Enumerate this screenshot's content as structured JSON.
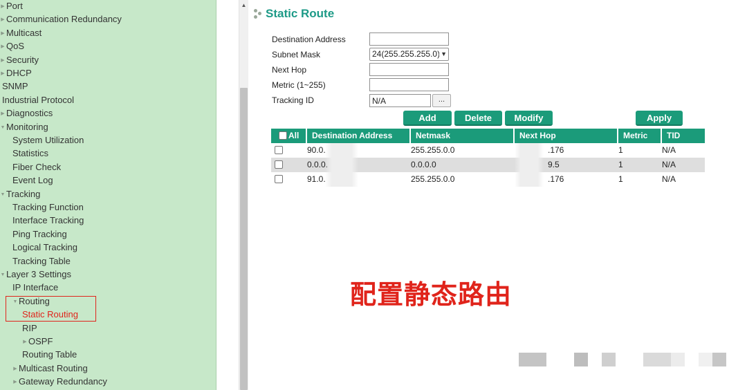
{
  "nav": {
    "items": [
      {
        "label": "Port",
        "indent": 0,
        "arrow": "right"
      },
      {
        "label": "Communication Redundancy",
        "indent": 0,
        "arrow": "right"
      },
      {
        "label": "Multicast",
        "indent": 0,
        "arrow": "right"
      },
      {
        "label": "QoS",
        "indent": 0,
        "arrow": "right"
      },
      {
        "label": "Security",
        "indent": 0,
        "arrow": "right"
      },
      {
        "label": "DHCP",
        "indent": 0,
        "arrow": "right"
      },
      {
        "label": "SNMP",
        "indent": 0,
        "arrow": "none"
      },
      {
        "label": "Industrial Protocol",
        "indent": 0,
        "arrow": "none"
      },
      {
        "label": "Diagnostics",
        "indent": 0,
        "arrow": "right"
      },
      {
        "label": "Monitoring",
        "indent": 0,
        "arrow": "down"
      },
      {
        "label": "System Utilization",
        "indent": 1,
        "arrow": "none"
      },
      {
        "label": "Statistics",
        "indent": 1,
        "arrow": "none"
      },
      {
        "label": "Fiber Check",
        "indent": 1,
        "arrow": "none"
      },
      {
        "label": "Event Log",
        "indent": 1,
        "arrow": "none"
      },
      {
        "label": "Tracking",
        "indent": 0,
        "arrow": "down"
      },
      {
        "label": "Tracking Function",
        "indent": 1,
        "arrow": "none"
      },
      {
        "label": "Interface Tracking",
        "indent": 1,
        "arrow": "none"
      },
      {
        "label": "Ping Tracking",
        "indent": 1,
        "arrow": "none"
      },
      {
        "label": "Logical Tracking",
        "indent": 1,
        "arrow": "none"
      },
      {
        "label": "Tracking Table",
        "indent": 1,
        "arrow": "none"
      },
      {
        "label": "Layer 3 Settings",
        "indent": 0,
        "arrow": "down"
      },
      {
        "label": "IP Interface",
        "indent": 1,
        "arrow": "none"
      },
      {
        "label": "Routing",
        "indent": 1,
        "arrow": "down"
      },
      {
        "label": "Static Routing",
        "indent": 2,
        "arrow": "none",
        "selected": true
      },
      {
        "label": "RIP",
        "indent": 2,
        "arrow": "none"
      },
      {
        "label": "OSPF",
        "indent": 2,
        "arrow": "right"
      },
      {
        "label": "Routing Table",
        "indent": 2,
        "arrow": "none"
      },
      {
        "label": "Multicast Routing",
        "indent": 1,
        "arrow": "right"
      },
      {
        "label": "Gateway Redundancy",
        "indent": 1,
        "arrow": "right"
      }
    ]
  },
  "page": {
    "title": "Static Route"
  },
  "form": {
    "destination_label": "Destination Address",
    "destination_value": "",
    "subnet_label": "Subnet Mask",
    "subnet_value": "24(255.255.255.0)",
    "nexthop_label": "Next Hop",
    "nexthop_value": "",
    "metric_label": "Metric (1~255)",
    "metric_value": "",
    "tracking_label": "Tracking ID",
    "tracking_value": "N/A",
    "tracking_button": "..."
  },
  "buttons": {
    "add": "Add",
    "delete": "Delete",
    "modify": "Modify",
    "apply": "Apply"
  },
  "table": {
    "headers": [
      "All",
      "Destination Address",
      "Netmask",
      "Next Hop",
      "Metric",
      "TID"
    ],
    "rows": [
      {
        "dest": "90.0.",
        "netmask": "255.255.0.0",
        "nexthop": ".176",
        "metric": "1",
        "tid": "N/A"
      },
      {
        "dest": "0.0.0.",
        "netmask": "0.0.0.0",
        "nexthop": "9.5",
        "metric": "1",
        "tid": "N/A"
      },
      {
        "dest": "91.0.",
        "netmask": "255.255.0.0",
        "nexthop": ".176",
        "metric": "1",
        "tid": "N/A"
      }
    ]
  },
  "annotation": "配置静态路由",
  "colors": {
    "accent": "#1b9b7a",
    "title": "#1d9a87",
    "highlight": "#e0241b",
    "nav_bg": "#c7e8c9"
  }
}
